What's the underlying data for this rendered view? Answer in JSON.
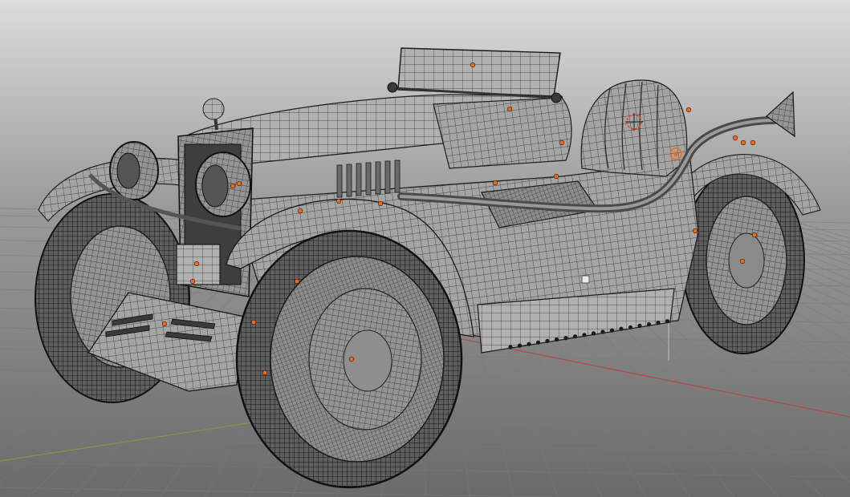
{
  "viewport": {
    "mode": "3D viewport",
    "shading": "solid",
    "overlay": "wireframe",
    "show_floor_grid": true
  },
  "scene": {
    "object_kind": "vintage open-top roadster",
    "selected_objects": 14,
    "origin_marker_color": "#f06a1e",
    "cursor_marker_color": "#e04020"
  },
  "axes": {
    "x_axis_color": "#b24a4a",
    "y_axis_color": "#7a9a44"
  },
  "colors": {
    "sky_top": "#dcdcdc",
    "sky_bottom": "#9a9a9a",
    "floor": "#6c6c6c",
    "grid_line": "#7c7c7c",
    "body": "#9c9c9c",
    "wire": "#2a2a2a",
    "tire": "#5a5a5a"
  }
}
